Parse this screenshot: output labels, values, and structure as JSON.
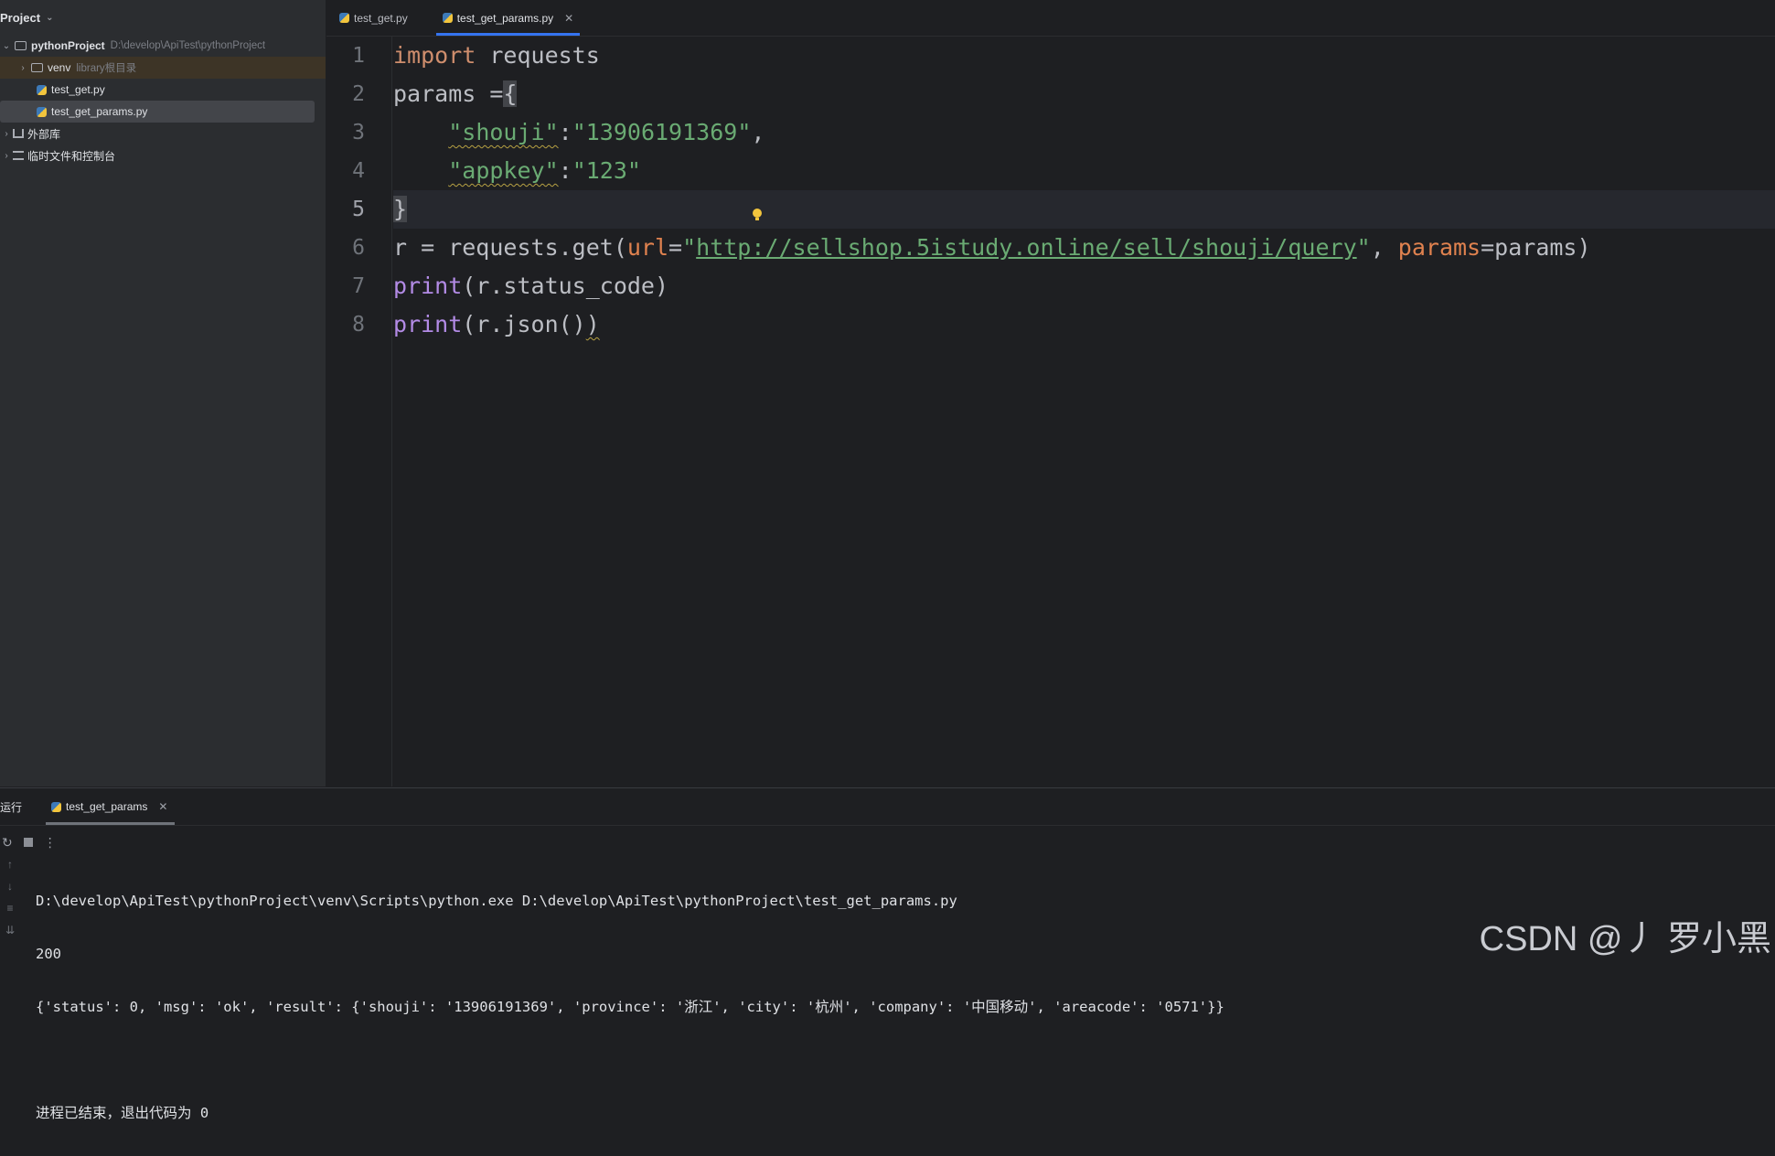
{
  "sidebar": {
    "title": "Project",
    "items": [
      {
        "name": "pythonProject",
        "path": "D:\\develop\\ApiTest\\pythonProject"
      },
      {
        "name": "venv",
        "path": "library根目录"
      },
      {
        "name": "test_get.py"
      },
      {
        "name": "test_get_params.py"
      },
      {
        "name": "外部库"
      },
      {
        "name": "临时文件和控制台"
      }
    ]
  },
  "tabs": [
    {
      "label": "test_get.py"
    },
    {
      "label": "test_get_params.py",
      "active": true
    }
  ],
  "editor": {
    "line_numbers": [
      "1",
      "2",
      "3",
      "4",
      "5",
      "6",
      "7",
      "8"
    ],
    "current_line": "5",
    "tokens": {
      "import": "import",
      "requests": " requests",
      "params_assign": "params =",
      "open_brace": "{",
      "indent": "    ",
      "key_shouji": "\"shouji\"",
      "colon": ":",
      "val_shouji": "\"13906191369\"",
      "comma": ",",
      "key_appkey": "\"appkey\"",
      "val_appkey": "\"123\"",
      "close_brace": "}",
      "r_assign": "r = requests.get(",
      "url_kw": "url",
      "eq": "=",
      "quote": "\"",
      "url_val": "http://sellshop.5istudy.online/sell/shouji/query",
      "comma_space": ", ",
      "params_kw": "params",
      "params_tail": "=params)",
      "print": "print",
      "status_arg": "(r.status_code)",
      "json_arg": "(r.json()",
      "close_paren": ")"
    }
  },
  "run": {
    "title": "运行",
    "tab": "test_get_params",
    "console": [
      "D:\\develop\\ApiTest\\pythonProject\\venv\\Scripts\\python.exe D:\\develop\\ApiTest\\pythonProject\\test_get_params.py",
      "200",
      "{'status': 0, 'msg': 'ok', 'result': {'shouji': '13906191369', 'province': '浙江', 'city': '杭州', 'company': '中国移动', 'areacode': '0571'}}",
      "",
      "进程已结束，退出代码为 0"
    ]
  },
  "watermark": "CSDN @丿 罗小黑",
  "colors": {
    "accent": "#3574f0",
    "keyword": "#cf8e6d",
    "string": "#6aab73",
    "function": "#b38be6",
    "param": "#e0824f"
  }
}
